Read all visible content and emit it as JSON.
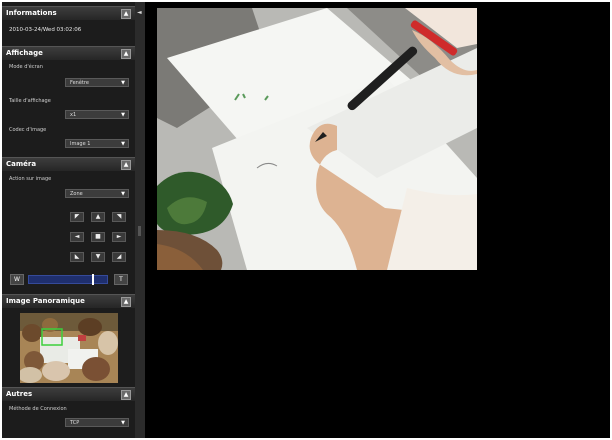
{
  "informations": {
    "title": "Informations",
    "collapse_icon": "collapse-icon",
    "datetime": "2010-03-24/Wed 03:02:06"
  },
  "affichage": {
    "title": "Affichage",
    "collapse_icon": "collapse-icon",
    "mode_label": "Mode d'écran",
    "mode_value": "Fenêtre",
    "taille_label": "Taille d'affichage",
    "taille_value": "x1",
    "codec_label": "Codec d'image",
    "codec_value": "Image 1"
  },
  "camera": {
    "title": "Caméra",
    "collapse_icon": "collapse-icon",
    "action_label": "Action sur image",
    "action_value": "Zone",
    "ptz_icons": [
      "arrow-up-left-icon",
      "arrow-up-icon",
      "arrow-up-right-icon",
      "arrow-left-icon",
      "home-icon",
      "arrow-right-icon",
      "arrow-down-left-icon",
      "arrow-down-icon",
      "arrow-down-right-icon"
    ],
    "zoom_wide": "W",
    "zoom_tele": "T",
    "zoom_level": 0.83
  },
  "panorama": {
    "title": "Image Panoramique",
    "collapse_icon": "collapse-icon"
  },
  "autres": {
    "title": "Autres",
    "collapse_icon": "collapse-icon",
    "connexion_label": "Méthode de Connexion",
    "connexion_value": "TCP"
  },
  "glyphs": {
    "collapse": "▲",
    "dropdown": "▼",
    "splitter": "◄",
    "ptz": [
      "◤",
      "▲",
      "◥",
      "◄",
      "■",
      "►",
      "◣",
      "▼",
      "◢"
    ]
  },
  "colors": {
    "panel": "#1c1c1c",
    "zoom_bar": "#1f2f6e",
    "background": "#000000"
  }
}
